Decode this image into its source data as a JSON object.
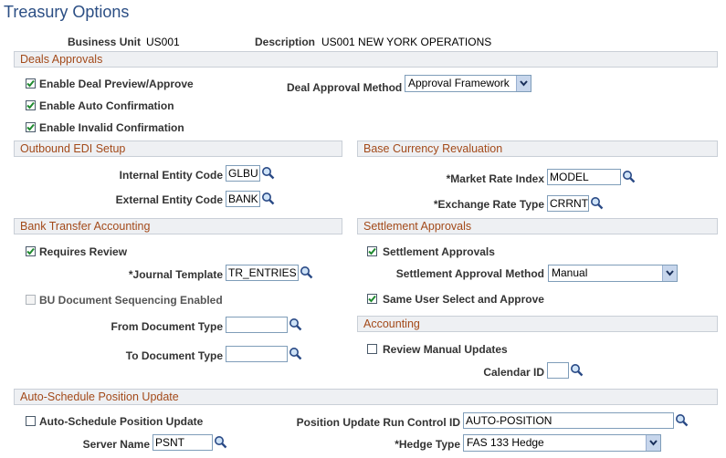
{
  "page": {
    "title": "Treasury Options"
  },
  "header": {
    "business_unit_label": "Business Unit",
    "business_unit_value": "US001",
    "description_label": "Description",
    "description_value": "US001 NEW YORK OPERATIONS"
  },
  "deals": {
    "section": "Deals Approvals",
    "enable_preview": "Enable Deal Preview/Approve",
    "enable_auto": "Enable Auto Confirmation",
    "enable_invalid": "Enable Invalid Confirmation",
    "method_label": "Deal Approval Method",
    "method_value": "Approval Framework"
  },
  "edi": {
    "section": "Outbound EDI Setup",
    "internal_label": "Internal Entity Code",
    "internal_value": "GLBU",
    "external_label": "External Entity Code",
    "external_value": "BANK"
  },
  "reval": {
    "section": "Base Currency Revaluation",
    "market_label": "*Market Rate Index",
    "market_value": "MODEL",
    "exchange_label": "*Exchange Rate Type",
    "exchange_value": "CRRNT"
  },
  "bank": {
    "section": "Bank Transfer Accounting",
    "requires_review": "Requires Review",
    "journal_label": "*Journal Template",
    "journal_value": "TR_ENTRIES",
    "bu_seq": "BU Document Sequencing Enabled",
    "from_label": "From Document Type",
    "from_value": "",
    "to_label": "To Document Type",
    "to_value": ""
  },
  "settle": {
    "section": "Settlement Approvals",
    "approvals": "Settlement Approvals",
    "method_label": "Settlement Approval Method",
    "method_value": "Manual",
    "same_user": "Same User Select and Approve"
  },
  "accounting": {
    "section": "Accounting",
    "review_manual": "Review Manual Updates",
    "calendar_label": "Calendar ID",
    "calendar_value": ""
  },
  "auto": {
    "section": "Auto-Schedule Position Update",
    "auto_schedule": "Auto-Schedule Position Update",
    "run_control_label": "Position Update Run Control ID",
    "run_control_value": "AUTO-POSITION",
    "server_label": "Server Name",
    "server_value": "PSNT",
    "hedge_label": "*Hedge Type",
    "hedge_value": "FAS 133 Hedge"
  },
  "colors": {
    "title": "#2b4e84",
    "section_text": "#a34a1a",
    "section_bg": "#eef0f3",
    "check": "#1f8a2f"
  }
}
